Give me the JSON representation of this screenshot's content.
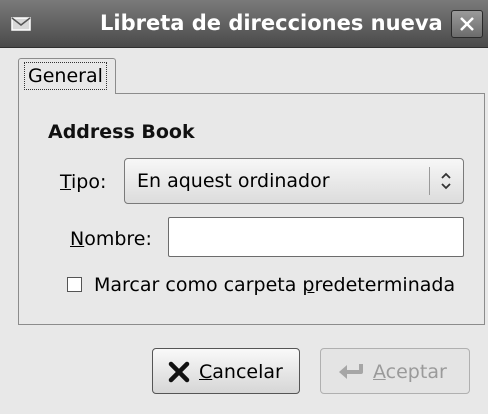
{
  "window": {
    "title": "Libreta de direcciones nueva",
    "icons": {
      "app": "envelope-icon",
      "close": "close-icon"
    }
  },
  "tabs": [
    {
      "label": "General",
      "active": true
    }
  ],
  "section": {
    "heading": "Address Book"
  },
  "form": {
    "type": {
      "label_mnemonic": "T",
      "label_rest": "ipo:",
      "value": "En aquest ordinador",
      "icon": "spinner-arrows-icon"
    },
    "name": {
      "label_mnemonic": "N",
      "label_rest": "ombre:",
      "value": ""
    },
    "default_folder": {
      "label_before": "Marcar como carpeta ",
      "label_mnemonic": "p",
      "label_after": "redeterminada",
      "checked": false
    }
  },
  "buttons": {
    "cancel": {
      "mnemonic": "C",
      "rest": "ancelar",
      "icon": "x-icon",
      "enabled": true
    },
    "accept": {
      "mnemonic": "A",
      "rest": "ceptar",
      "icon": "return-arrow-icon",
      "enabled": false
    }
  }
}
